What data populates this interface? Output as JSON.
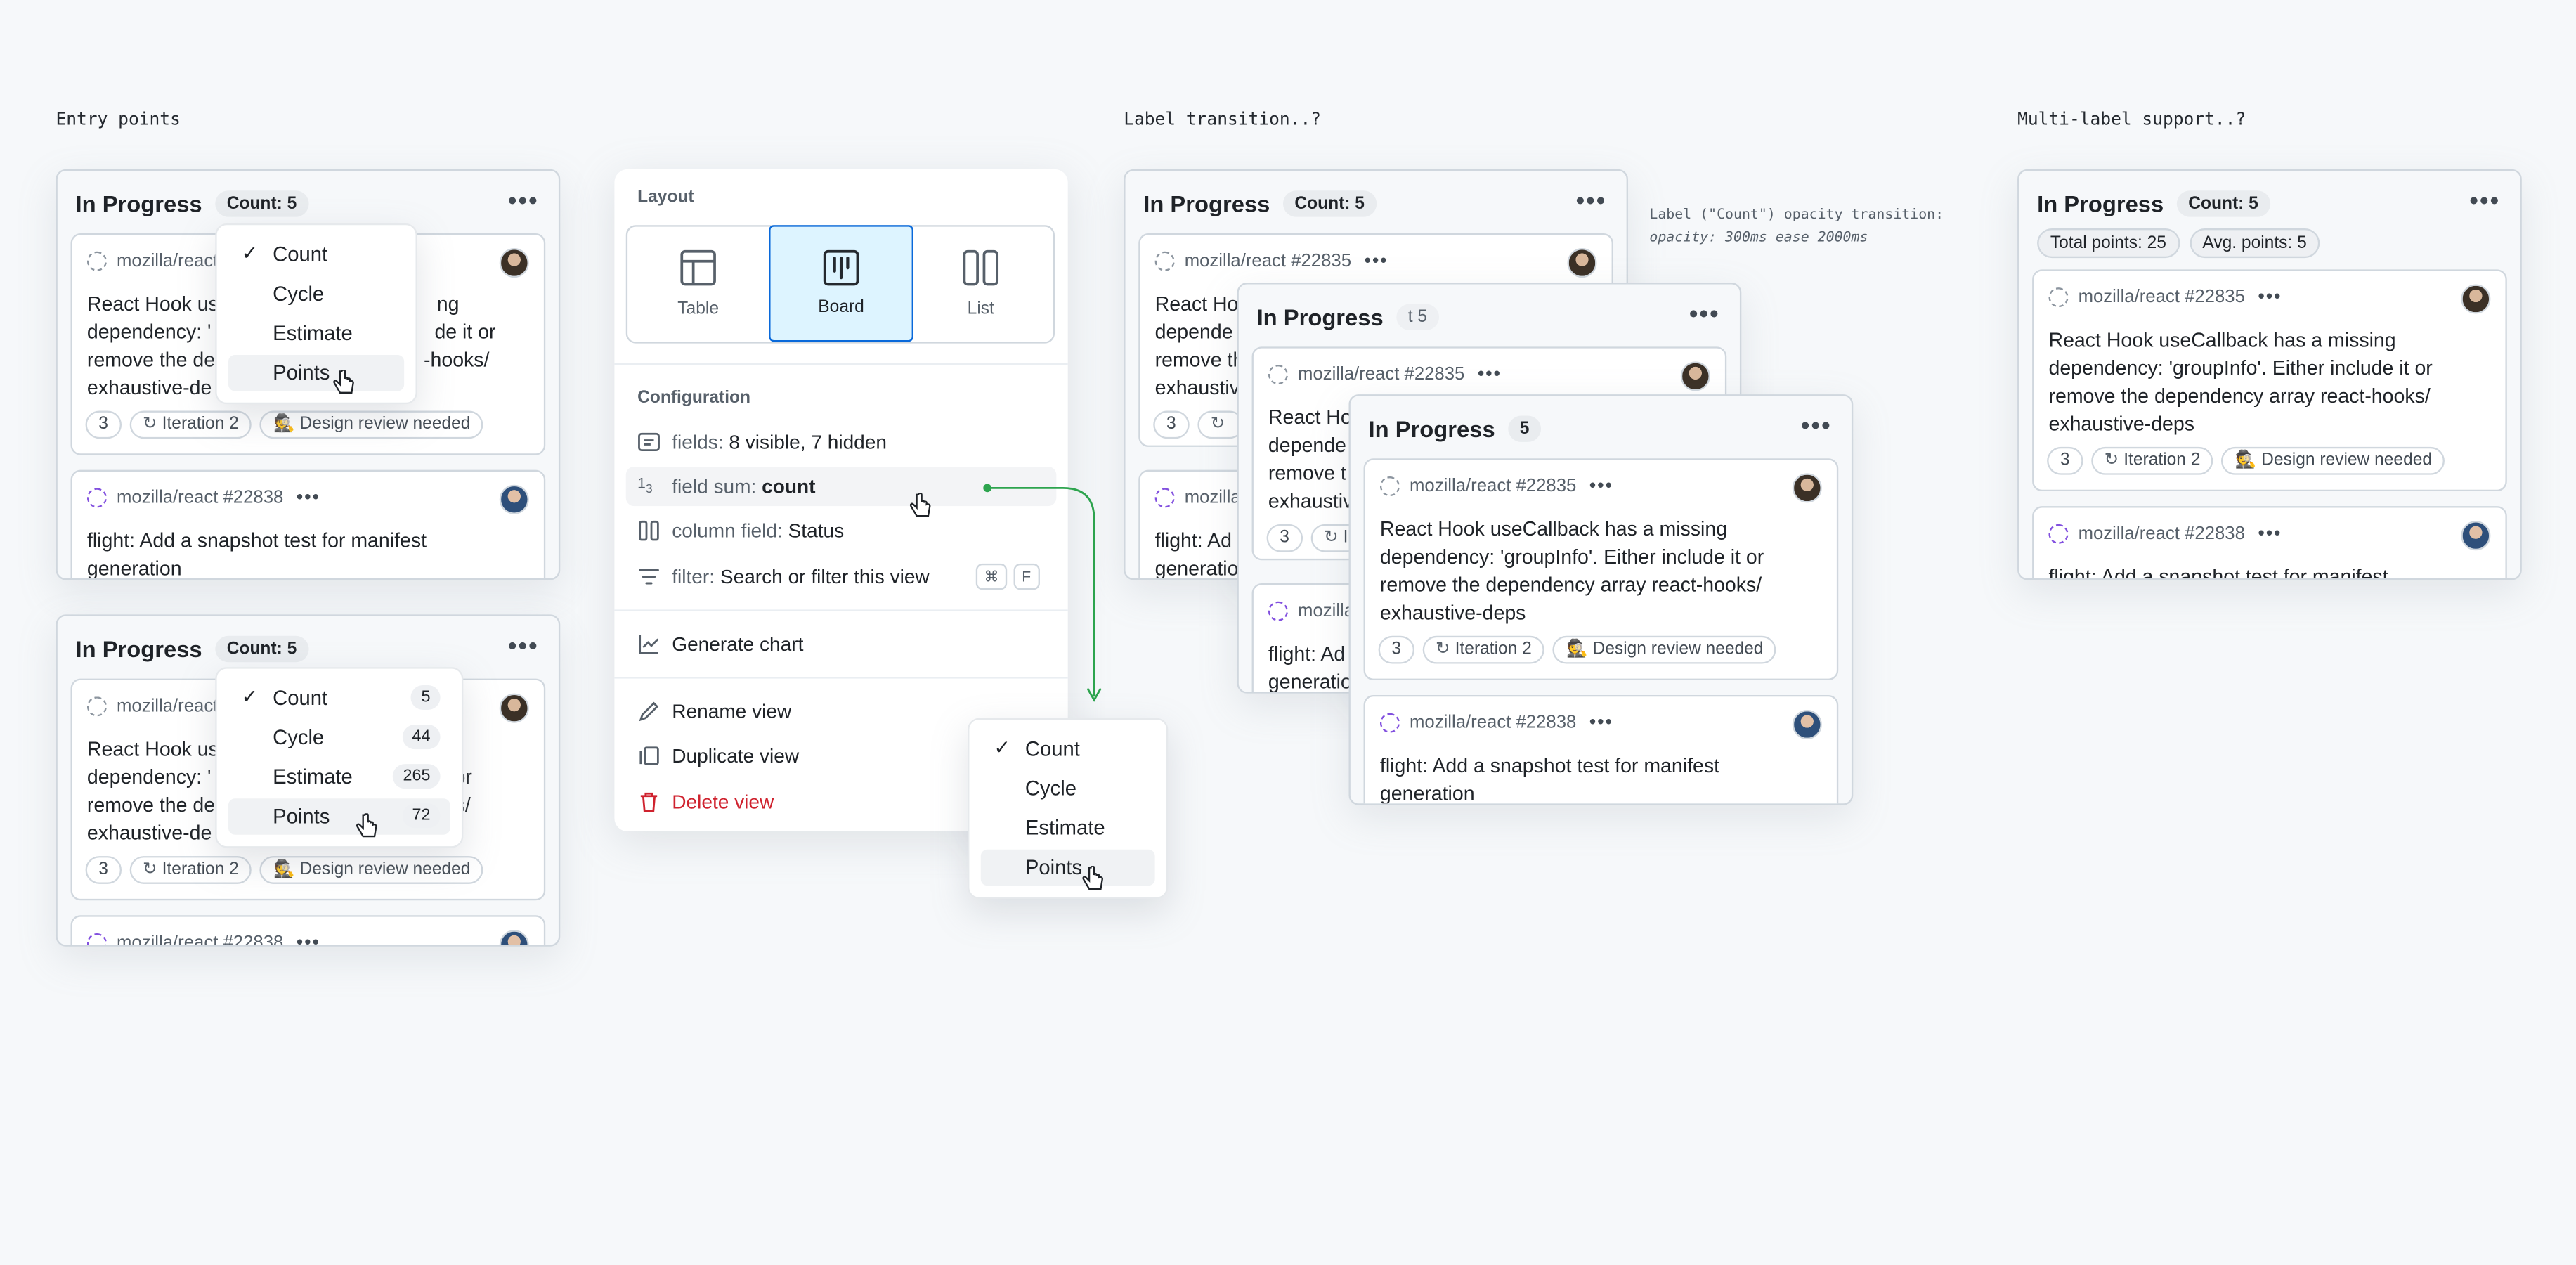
{
  "sections": {
    "entry_points": "Entry points",
    "label_transition": "Label transition..?",
    "multi_label": "Multi-label support..?",
    "note_line1": "Label (\"Count\") opacity transition:",
    "note_line2": "opacity: 300ms ease 2000ms"
  },
  "column": {
    "title": "In Progress",
    "count_pill": "Count: 5",
    "count_fade": "t 5",
    "count_plain": "5",
    "total_points": "Total points: 25",
    "avg_points": "Avg. points: 5",
    "more": "•••"
  },
  "card1": {
    "repo": "mozilla/react #22835",
    "repo_short": "mozilla/react",
    "title": "React Hook useCallback has a missing dependency: 'groupInfo'. Either include it or remove the dependency array  react-hooks/ exhaustive-deps",
    "t1_l1": "React Hook us",
    "t1_l1b": "ng",
    "t1_l2": "dependency: '",
    "t1_l2b": "de it or",
    "t1_l3": "remove the de",
    "t1_l3b": "-hooks/",
    "t1_l4": "exhaustive-de",
    "t2_l2b": "or",
    "t2_l3b": "ks/",
    "mid_l1": "React Ho",
    "mid_l2": "depende",
    "mid_l3": "remove t",
    "mid_l4": "exhaustiv",
    "back_l1": "React Ho",
    "back_l2": "depende",
    "back_l3": "remove th",
    "back_l4": "exhaustiv",
    "tag_num": "3",
    "tag_iteration": "Iteration 2",
    "tag_design": "Design review needed",
    "tag_iteration_cut": "I"
  },
  "card2": {
    "repo": "mozilla/react #22838",
    "repo_short": "mozilla",
    "title": "flight: Add a snapshot test for manifest generation",
    "title_cut1": "flight: Ad",
    "title_cut2": "generation",
    "title_cut_mid1": "flight: Ad",
    "title_cut_mid2": "generatio",
    "title_peek": "flight: Add a snapshot test for manifest"
  },
  "menu": {
    "count": "Count",
    "cycle": "Cycle",
    "estimate": "Estimate",
    "points": "Points",
    "count_n": "5",
    "cycle_n": "44",
    "estimate_n": "265",
    "points_n": "72",
    "check": "✓"
  },
  "panel": {
    "layout_heading": "Layout",
    "table": "Table",
    "board": "Board",
    "list": "List",
    "config_heading": "Configuration",
    "fields_label": "fields:",
    "fields_value": "8 visible, 7 hidden",
    "sum_label": "field sum:",
    "sum_value": "count",
    "column_label": "column field:",
    "column_value": "Status",
    "filter_label": "filter:",
    "filter_value": "Search or filter this view",
    "kbd_cmd": "⌘",
    "kbd_f": "F",
    "generate_chart": "Generate chart",
    "rename": "Rename view",
    "duplicate": "Duplicate view",
    "delete": "Delete view"
  },
  "colors": {
    "accent": "#0969da",
    "accent_bg": "#ddf4ff",
    "danger": "#cf222e",
    "connector": "#2da44e"
  }
}
